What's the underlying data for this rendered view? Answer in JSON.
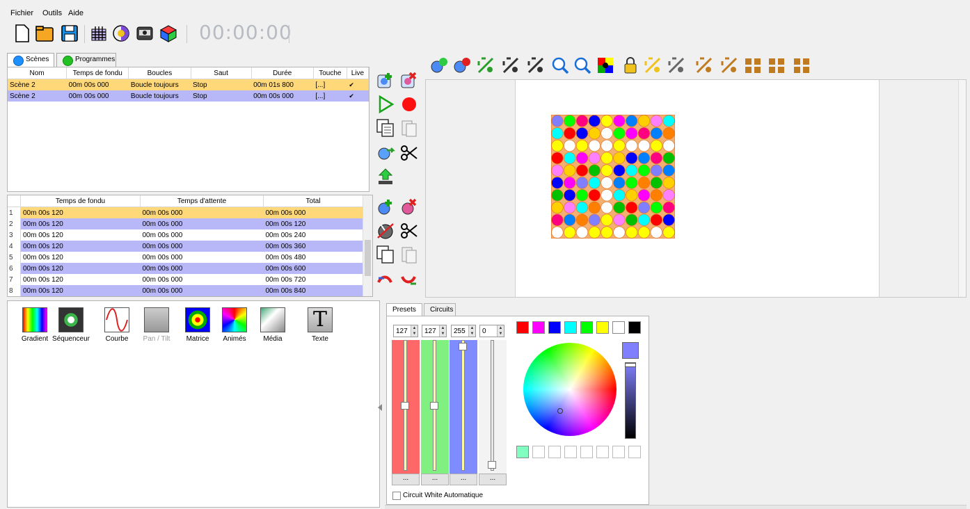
{
  "menu": [
    "Fichier",
    "Outils",
    "Aide"
  ],
  "toolbar": {
    "icons": [
      "new-file-icon",
      "open-folder-icon",
      "save-icon",
      "grid-icon",
      "color-blend-icon",
      "device-icon",
      "cube-icon"
    ],
    "timer": "00:00:00"
  },
  "tabs": {
    "scenes": "Scènes",
    "programmes": "Programmes",
    "scenes_color": "#1e90ff",
    "programmes_color": "#22c022"
  },
  "scene_table": {
    "headers": [
      "Nom",
      "Temps de fondu",
      "Boucles",
      "Saut",
      "Durée",
      "Touche",
      "Live"
    ],
    "rows": [
      {
        "nom": "Scène 2",
        "fondu": "00m 00s 000",
        "boucles": "Boucle toujours",
        "saut": "Stop",
        "duree": "00m 01s 800",
        "touche": "[...]",
        "live": "✔"
      },
      {
        "nom": "Scène 2",
        "fondu": "00m 00s 000",
        "boucles": "Boucle toujours",
        "saut": "Stop",
        "duree": "00m 00s 000",
        "touche": "[...]",
        "live": "✔"
      }
    ]
  },
  "step_table": {
    "headers": [
      "Temps de fondu",
      "Temps d'attente",
      "Total"
    ],
    "rows": [
      {
        "n": "1",
        "fondu": "00m 00s 120",
        "attente": "00m 00s 000",
        "total": "00m 00s 000"
      },
      {
        "n": "2",
        "fondu": "00m 00s 120",
        "attente": "00m 00s 000",
        "total": "00m 00s 120"
      },
      {
        "n": "3",
        "fondu": "00m 00s 120",
        "attente": "00m 00s 000",
        "total": "00m 00s 240"
      },
      {
        "n": "4",
        "fondu": "00m 00s 120",
        "attente": "00m 00s 000",
        "total": "00m 00s 360"
      },
      {
        "n": "5",
        "fondu": "00m 00s 120",
        "attente": "00m 00s 000",
        "total": "00m 00s 480"
      },
      {
        "n": "6",
        "fondu": "00m 00s 120",
        "attente": "00m 00s 000",
        "total": "00m 00s 600"
      },
      {
        "n": "7",
        "fondu": "00m 00s 120",
        "attente": "00m 00s 000",
        "total": "00m 00s 720"
      },
      {
        "n": "8",
        "fondu": "00m 00s 120",
        "attente": "00m 00s 000",
        "total": "00m 00s 840"
      }
    ]
  },
  "effects": [
    {
      "label": "Gradient",
      "icon": "gradient-icon"
    },
    {
      "label": "Séquenceur",
      "icon": "sequencer-icon"
    },
    {
      "label": "Courbe",
      "icon": "curve-icon"
    },
    {
      "label": "Pan / Tilt",
      "icon": "pan-tilt-icon"
    },
    {
      "label": "Matrice",
      "icon": "matrix-icon"
    },
    {
      "label": "Animés",
      "icon": "animated-icon"
    },
    {
      "label": "Média",
      "icon": "media-icon"
    },
    {
      "label": "Texte",
      "icon": "text-icon"
    }
  ],
  "presets": {
    "tab_presets": "Presets",
    "tab_circuits": "Circuits",
    "red_value": "127",
    "green_value": "127",
    "blue_value": "255",
    "white_value": "0",
    "red_level": 0.5,
    "green_level": 0.5,
    "blue_level": 1.0,
    "white_level": 0.0,
    "more_label": "...",
    "auto_white_label": "Circuit White Automatique",
    "palette": [
      "#ff0000",
      "#ff00ff",
      "#0000ff",
      "#00ffff",
      "#00ff00",
      "#ffff00",
      "#ffffff",
      "#000000"
    ],
    "selected_color": "#8080ff",
    "first_custom": "#80ffc0"
  },
  "matrix": {
    "rows": 10,
    "cols": 10,
    "colors": [
      "#7f7fff",
      "#0000ff",
      "#0080ff",
      "#00ffff",
      "#00c000",
      "#00ff00",
      "#ffff00",
      "#ffd000",
      "#ff8000",
      "#ff0000",
      "#ff0080",
      "#ff00ff",
      "#ff80ff",
      "#ffffff"
    ]
  }
}
